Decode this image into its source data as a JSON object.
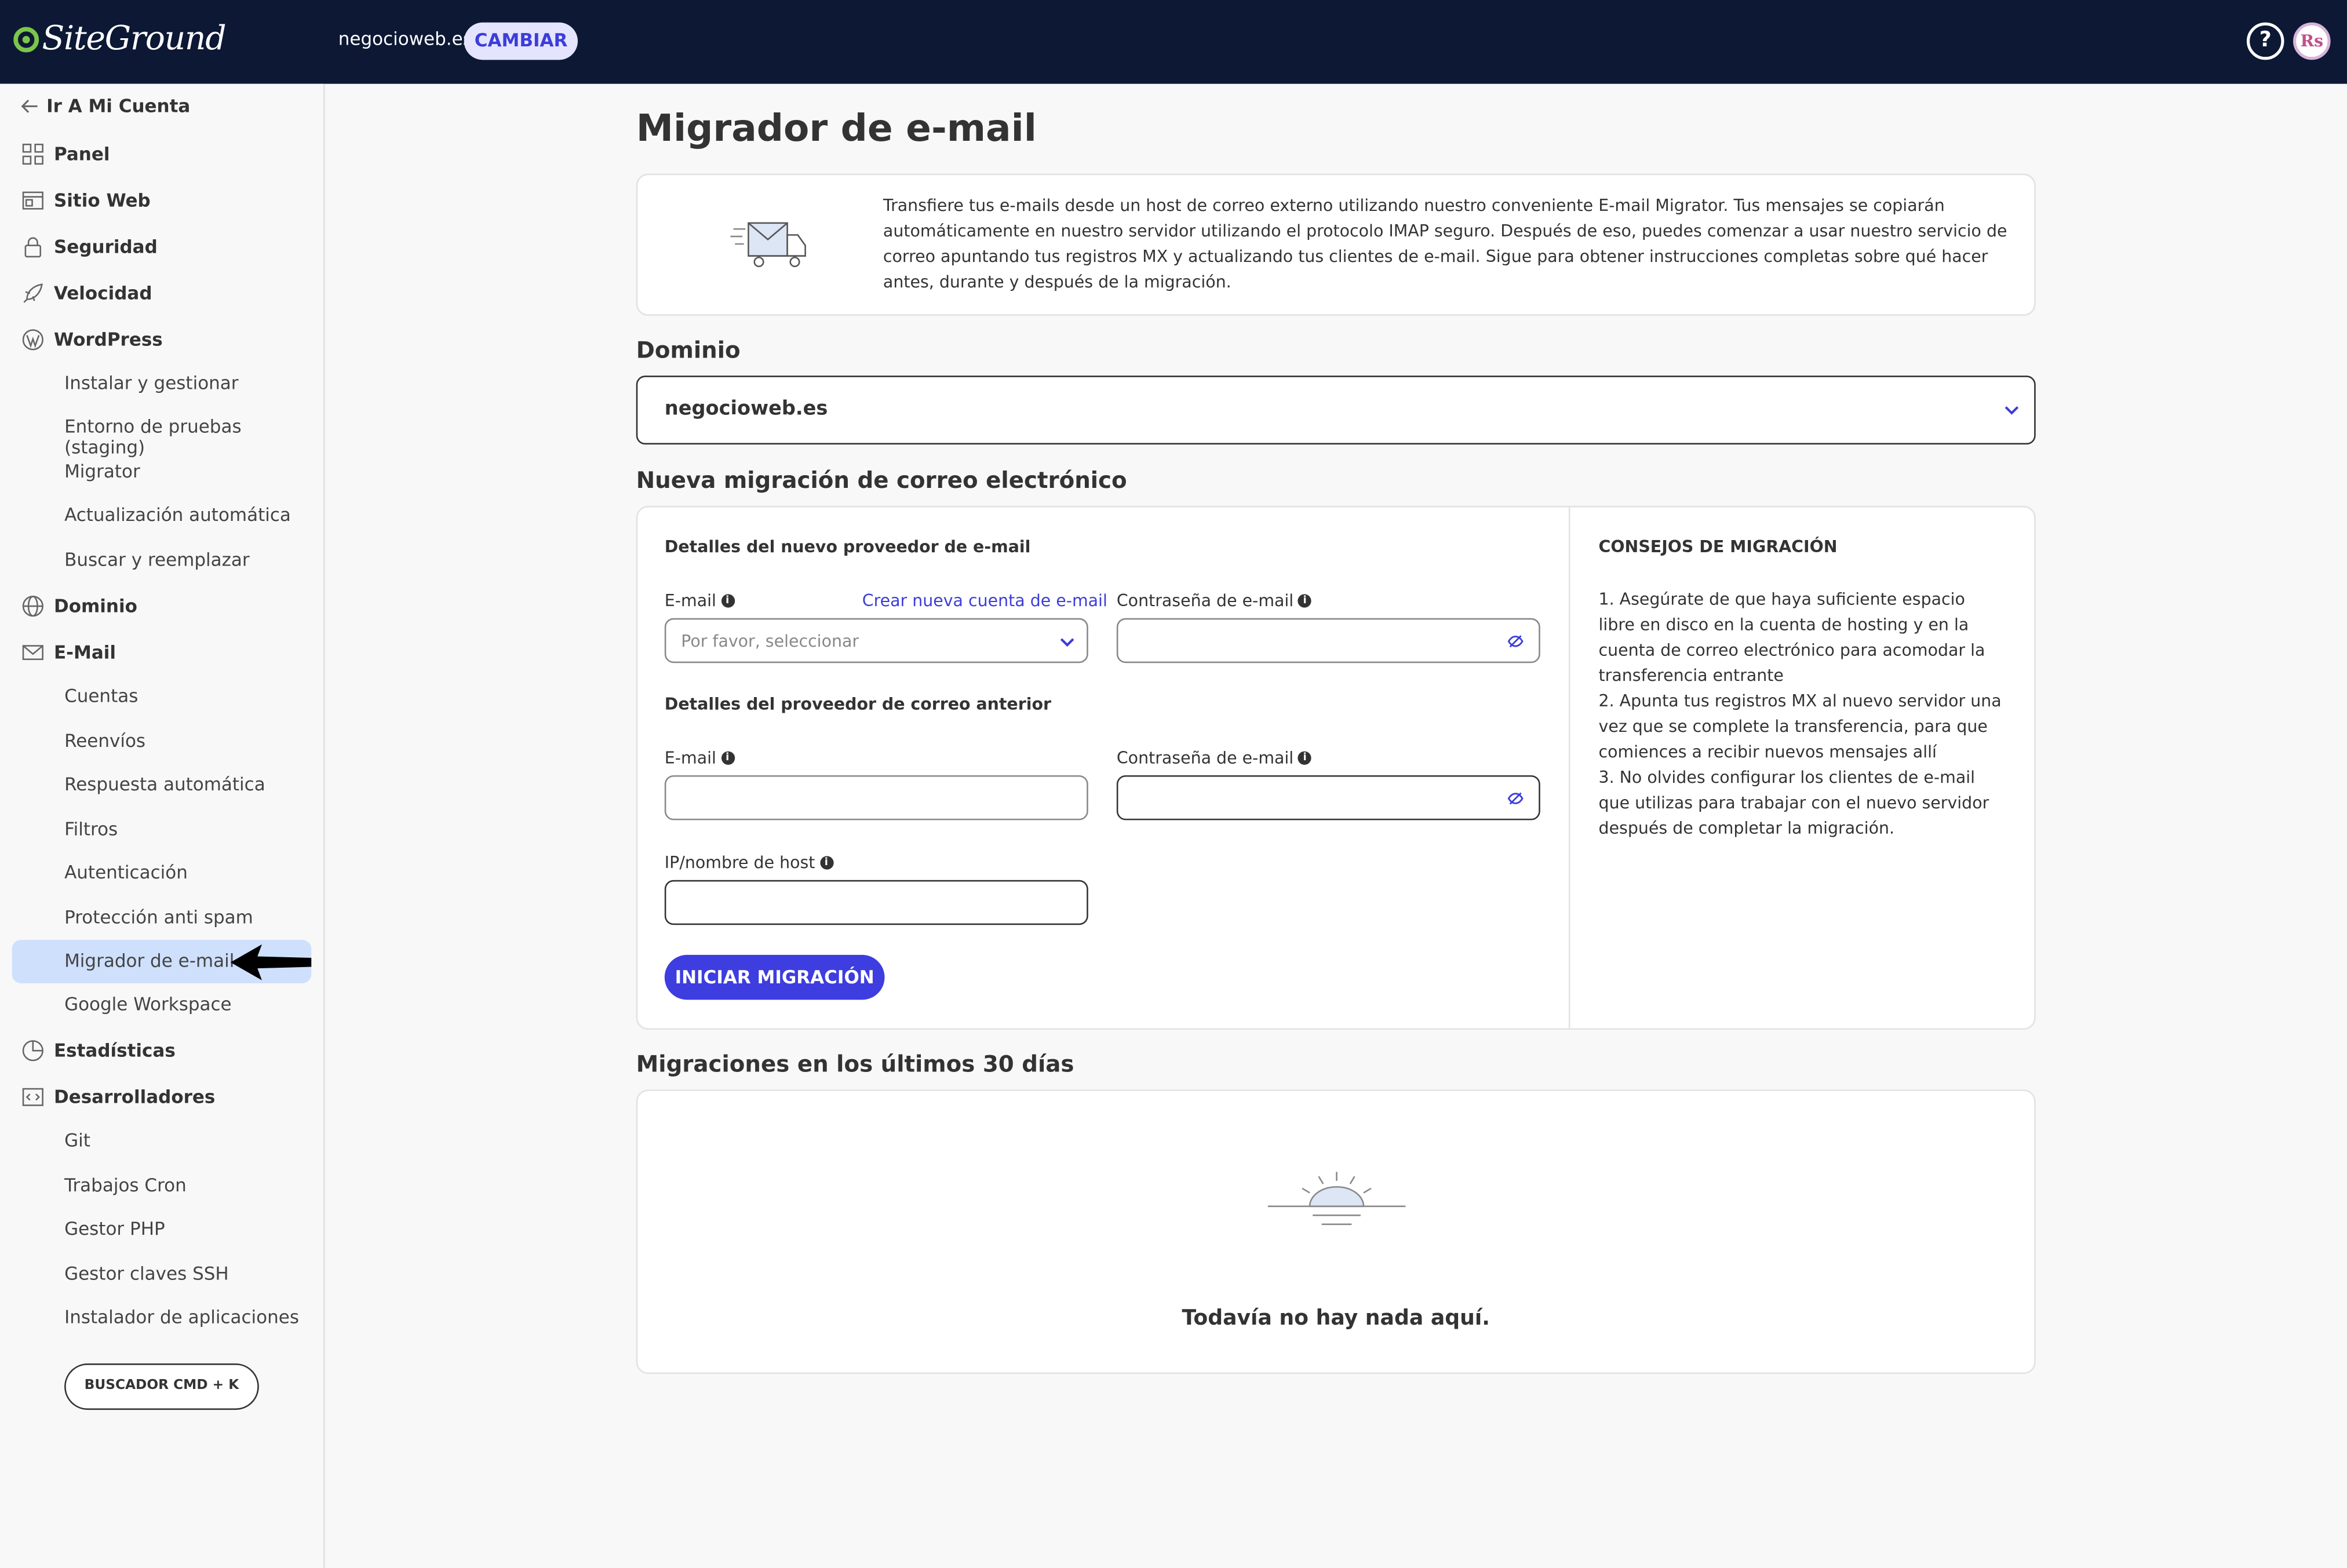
{
  "topbar": {
    "logo": "SiteGround",
    "domain": "negocioweb.es",
    "switch_label": "CAMBIAR",
    "help_icon": "question-icon",
    "avatar_initials": "Rs"
  },
  "sidebar": {
    "back_label": "Ir A Mi Cuenta",
    "sections": {
      "panel": "Panel",
      "sitio_web": "Sitio Web",
      "seguridad": "Seguridad",
      "velocidad": "Velocidad",
      "wordpress": "WordPress",
      "dominio": "Dominio",
      "email": "E-Mail",
      "estadisticas": "Estadísticas",
      "desarrolladores": "Desarrolladores"
    },
    "wordpress_items": [
      "Instalar y gestionar",
      "Entorno de pruebas (staging)",
      "Migrator",
      "Actualización automática",
      "Buscar y reemplazar"
    ],
    "email_items": [
      "Cuentas",
      "Reenvíos",
      "Respuesta automática",
      "Filtros",
      "Autenticación",
      "Protección anti spam",
      "Migrador de e-mail",
      "Google Workspace"
    ],
    "dev_items": [
      "Git",
      "Trabajos Cron",
      "Gestor PHP",
      "Gestor claves SSH",
      "Instalador de aplicaciones"
    ],
    "active_item": "Migrador de e-mail",
    "search_button": "BUSCADOR CMD + K"
  },
  "main": {
    "title": "Migrador de e-mail",
    "info_text": "Transfiere tus e-mails desde un host de correo externo utilizando nuestro conveniente E-mail Migrator. Tus mensajes se copiarán automáticamente en nuestro servidor utilizando el protocolo IMAP seguro. Después de eso, puedes comenzar a usar nuestro servicio de correo apuntando tus registros MX y actualizando tus clientes de e-mail. Sigue  para obtener instrucciones completas sobre qué hacer antes, durante y después de la migración.",
    "domain_label": "Dominio",
    "domain_value": "negocioweb.es",
    "new_migration_label": "Nueva migración de correo electrónico",
    "new_provider_heading": "Detalles del nuevo proveedor de e-mail",
    "email_label": "E-mail",
    "create_account_link": "Crear nueva cuenta de e-mail",
    "password_label": "Contraseña de e-mail",
    "email_placeholder": "Por favor, seleccionar",
    "old_provider_heading": "Detalles del proveedor de correo anterior",
    "old_email_label": "E-mail",
    "old_password_label": "Contraseña de e-mail",
    "host_label": "IP/nombre de host",
    "start_button": "INICIAR MIGRACIÓN",
    "tips_heading": "CONSEJOS DE MIGRACIÓN",
    "tips": [
      "1. Asegúrate de que haya suficiente espacio libre en disco en la cuenta de hosting y en la cuenta de correo electrónico para acomodar la transferencia entrante",
      "2. Apunta tus registros MX al nuevo servidor una vez que se complete la transferencia, para que comiences a recibir nuevos mensajes allí",
      "3. No olvides configurar los clientes de e-mail que utilizas para trabajar con el nuevo servidor después de completar la migración."
    ],
    "recent_label": "Migraciones en los últimos 30 días",
    "empty_text": "Todavía no hay nada aquí."
  },
  "colors": {
    "topbar": "#0c1834",
    "accent": "#3d3de0",
    "active_bg": "#cfe0fd",
    "logo_green": "#7cc54a"
  }
}
